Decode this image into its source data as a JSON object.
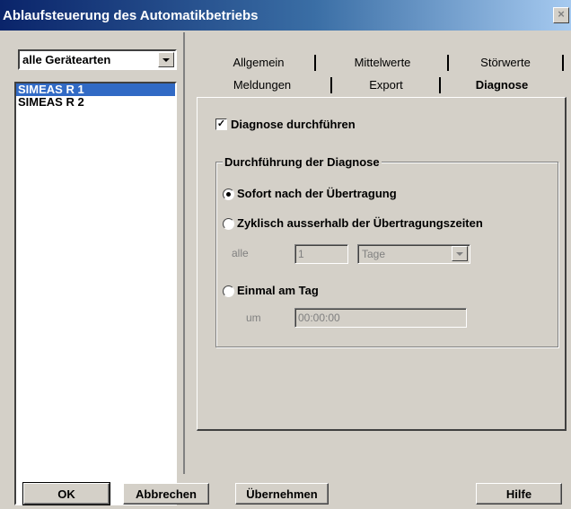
{
  "window": {
    "title": "Ablaufsteuerung des Automatikbetriebs",
    "close_symbol": "×"
  },
  "left": {
    "device_type_select": "alle Gerätearten",
    "devices": [
      "SIMEAS R 1",
      "SIMEAS R 2"
    ],
    "selected_device": "SIMEAS R 1"
  },
  "tabs": {
    "row1": [
      "Allgemein",
      "Mittelwerte",
      "Störwerte"
    ],
    "row2": [
      "Meldungen",
      "Export",
      "Diagnose"
    ],
    "active": "Diagnose"
  },
  "diagnose": {
    "checkbox_label": "Diagnose durchführen",
    "checked": true,
    "group_title": "Durchführung der Diagnose",
    "option_immediate": "Sofort nach der Übertragung",
    "option_cyclic": "Zyklisch ausserhalb der Übertragungszeiten",
    "option_daily": "Einmal am Tag",
    "selected_option": "immediate",
    "every_label": "alle",
    "every_value": "1",
    "unit_select": "Tage",
    "time_label": "um",
    "time_value": "00:00:00"
  },
  "buttons": {
    "ok": "OK",
    "cancel": "Abbrechen",
    "apply": "Übernehmen",
    "help": "Hilfe"
  }
}
